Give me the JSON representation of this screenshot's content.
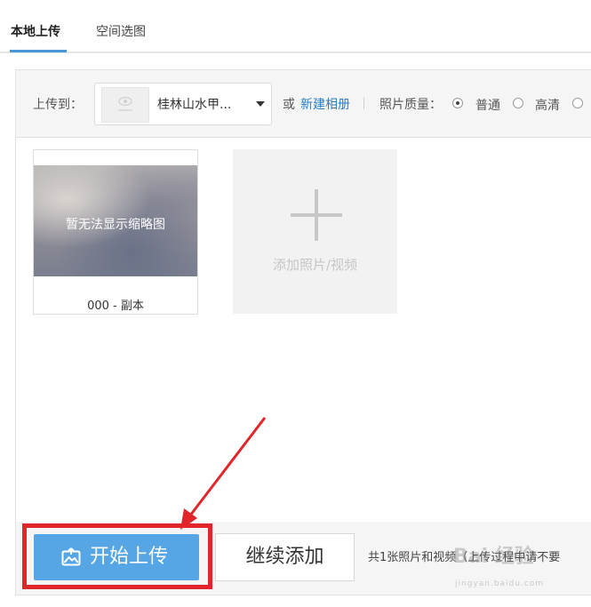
{
  "tabs": [
    {
      "label": "本地上传",
      "active": true
    },
    {
      "label": "空间选图",
      "active": false
    }
  ],
  "toolbar": {
    "upload_to_label": "上传到：",
    "album_name": "桂林山水甲...",
    "or_label": "或",
    "new_album_link": "新建相册",
    "quality_label": "照片质量：",
    "quality_options": [
      {
        "label": "普通",
        "checked": true
      },
      {
        "label": "高清",
        "checked": false
      }
    ]
  },
  "photos": [
    {
      "thumb_text": "暂无法显示缩略图",
      "caption": "000 - 副本"
    }
  ],
  "add_tile": {
    "label": "添加照片/视频"
  },
  "footer": {
    "start_button": "开始上传",
    "continue_button": "继续添加",
    "status_text": "共1张照片和视频（上传过程中请不要",
    "watermark": "Bai 经验",
    "watermark_sub": "jingyan.baidu.com"
  },
  "colors": {
    "accent": "#56a6e6",
    "link": "#2a7fc8",
    "highlight": "#e0262a",
    "tab_underline": "#4a98d8"
  },
  "icons": {
    "album_thumb": "image-placeholder-icon",
    "dropdown": "caret-down-icon",
    "add": "plus-icon",
    "start_upload": "photo-upload-icon",
    "annotation": "red-arrow"
  }
}
